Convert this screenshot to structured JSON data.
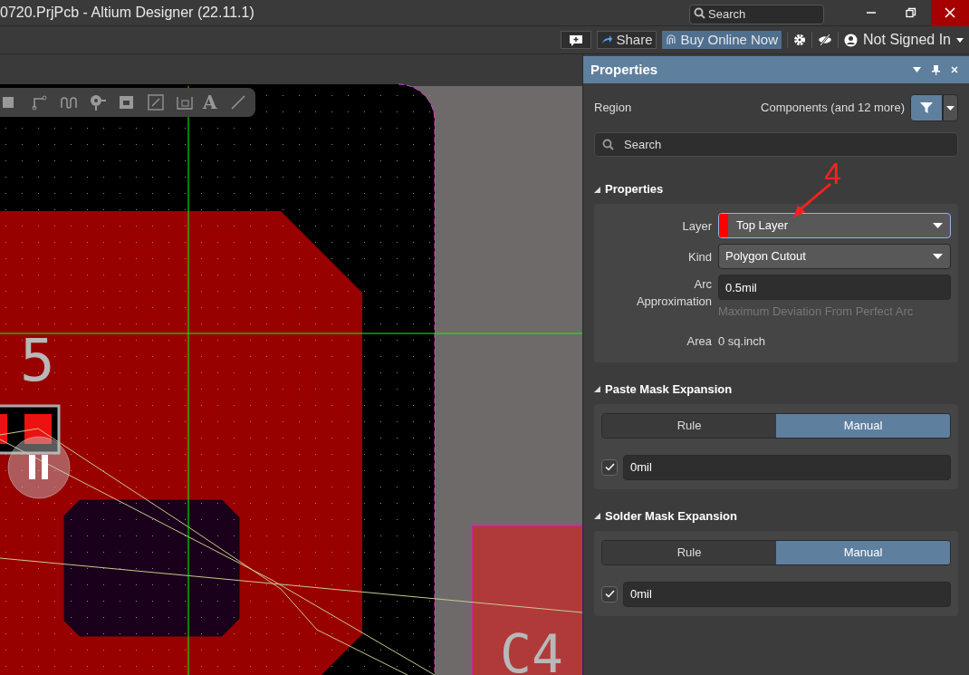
{
  "window": {
    "title": "0720.PrjPcb - Altium Designer (22.11.1)"
  },
  "title_search": {
    "placeholder": "Search"
  },
  "header_actions": {
    "share": "Share",
    "buy": "Buy Online Now",
    "account": "Not Signed In"
  },
  "canvas": {
    "toolbar_glyph": "A",
    "designators": [
      "5",
      "C4"
    ]
  },
  "annotation": {
    "label": "4"
  },
  "panel": {
    "title": "Properties",
    "object_type": "Region",
    "filter": "Components (and 12 more)",
    "search_placeholder": "Search",
    "sections": [
      {
        "kind": "fields",
        "title": "Properties",
        "expanded": true,
        "fields": [
          {
            "kind": "select",
            "label": "Layer",
            "value": "Top Layer",
            "color": "#ff0000",
            "focused": true
          },
          {
            "kind": "select",
            "label": "Kind",
            "value": "Polygon Cutout",
            "focused": false
          },
          {
            "kind": "input",
            "label": "Arc Approximation",
            "value": "0.5mil",
            "hint": "Maximum Deviation From Perfect Arc"
          },
          {
            "kind": "text",
            "label": "Area",
            "value": "0 sq.inch"
          }
        ]
      },
      {
        "kind": "mask",
        "title": "Paste Mask Expansion",
        "expanded": true,
        "modes": [
          {
            "label": "Rule",
            "selected": false
          },
          {
            "label": "Manual",
            "selected": true
          }
        ],
        "checked": true,
        "value": "0mil"
      },
      {
        "kind": "mask",
        "title": "Solder Mask Expansion",
        "expanded": true,
        "modes": [
          {
            "label": "Rule",
            "selected": false
          },
          {
            "label": "Manual",
            "selected": true
          }
        ],
        "checked": true,
        "value": "0mil"
      }
    ]
  }
}
